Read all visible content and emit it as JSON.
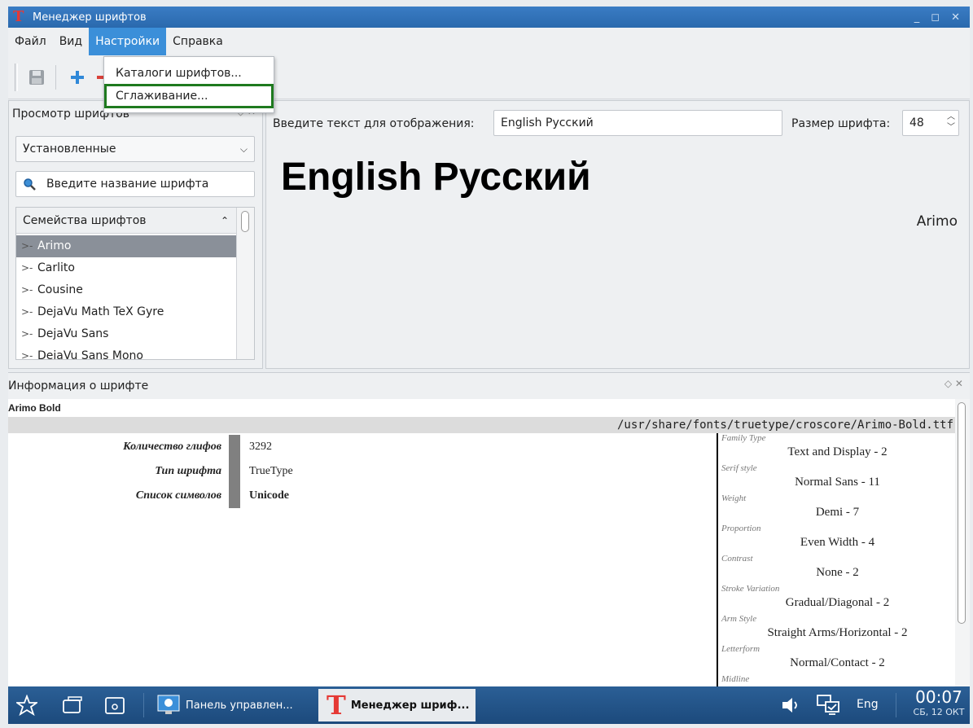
{
  "window": {
    "title": "Менеджер шрифтов"
  },
  "menubar": {
    "file": "Файл",
    "view": "Вид",
    "settings": "Настройки",
    "help": "Справка"
  },
  "settings_menu": {
    "items": [
      "Каталоги шрифтов...",
      "Сглаживание..."
    ],
    "highlight_color": "#1f7a1f"
  },
  "browser": {
    "title": "Просмотр шрифтов",
    "filter_value": "Установленные",
    "search_placeholder": "Введите название шрифта",
    "tree_header": "Семейства шрифтов",
    "families": [
      "Arimo",
      "Carlito",
      "Cousine",
      "DejaVu Math TeX Gyre",
      "DejaVu Sans",
      "DejaVu Sans Mono"
    ],
    "selected": "Arimo"
  },
  "preview": {
    "text_label": "Введите текст для отображения:",
    "text_value": "English Русский",
    "size_label": "Размер шрифта:",
    "size_value": "48",
    "sample": "English Русский",
    "font_name": "Arimo"
  },
  "info": {
    "title": "Информация о шрифте",
    "font_full_name": "Arimo Bold",
    "path": "/usr/share/fonts/truetype/croscore/Arimo-Bold.ttf",
    "props": [
      {
        "label": "Количество глифов",
        "value": "3292"
      },
      {
        "label": "Тип шрифта",
        "value": "TrueType"
      },
      {
        "label": "Список символов",
        "value": "Unicode"
      }
    ],
    "panose": [
      {
        "key": "Family Type",
        "value": "Text and Display - 2"
      },
      {
        "key": "Serif style",
        "value": "Normal Sans - 11"
      },
      {
        "key": "Weight",
        "value": "Demi - 7"
      },
      {
        "key": "Proportion",
        "value": "Even Width - 4"
      },
      {
        "key": "Contrast",
        "value": "None - 2"
      },
      {
        "key": "Stroke Variation",
        "value": "Gradual/Diagonal - 2"
      },
      {
        "key": "Arm Style",
        "value": "Straight Arms/Horizontal - 2"
      },
      {
        "key": "Letterform",
        "value": "Normal/Contact - 2"
      },
      {
        "key": "Midline",
        "value": ""
      }
    ]
  },
  "taskbar": {
    "tasks": [
      "Панель управлен...",
      "Менеджер шриф..."
    ],
    "lang": "Eng",
    "time": "00:07",
    "date": "СБ, 12 ОКТ"
  },
  "colors": {
    "accent": "#3b8fd9",
    "titlebar": "#2a69ad",
    "taskbar": "#1f4f82",
    "app_icon": "#e53935"
  }
}
